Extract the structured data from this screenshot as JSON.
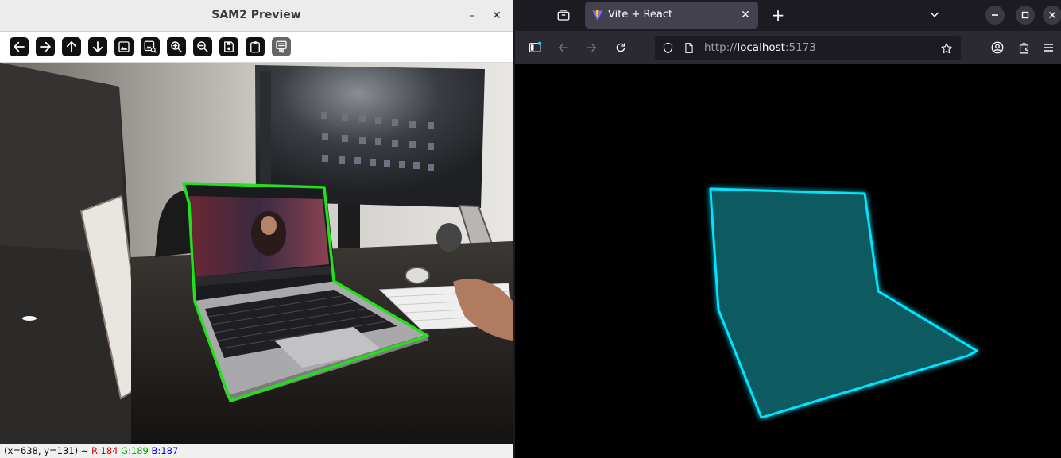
{
  "sam_window": {
    "title": "SAM2 Preview",
    "minimize_glyph": "–",
    "close_glyph": "✕",
    "toolbar": [
      {
        "name": "pan-left-icon",
        "glyph": "arrow-left"
      },
      {
        "name": "pan-right-icon",
        "glyph": "arrow-right"
      },
      {
        "name": "pan-up-icon",
        "glyph": "arrow-up"
      },
      {
        "name": "pan-down-icon",
        "glyph": "arrow-down"
      },
      {
        "name": "zoom-fit-icon",
        "glyph": "image"
      },
      {
        "name": "zoom-original-icon",
        "glyph": "image-magnify"
      },
      {
        "name": "zoom-in-icon",
        "glyph": "magnifier-plus"
      },
      {
        "name": "zoom-out-icon",
        "glyph": "magnifier-minus"
      },
      {
        "name": "save-icon",
        "glyph": "floppy"
      },
      {
        "name": "copy-icon",
        "glyph": "clipboard"
      },
      {
        "name": "properties-icon",
        "glyph": "settings-window"
      }
    ],
    "status": {
      "coords": "(x=638, y=131) ~ ",
      "r": "R:184",
      "g": "G:189",
      "b": "B:187"
    },
    "overlay_color": "#22e01a"
  },
  "browser": {
    "tab_title": "Vite + React",
    "new_tab_glyph": "+",
    "url_protocol": "http://",
    "url_host": "localhost",
    "url_port": ":5173",
    "mask_color": "#00e5ff",
    "mask_fill": "#0a5a60"
  }
}
